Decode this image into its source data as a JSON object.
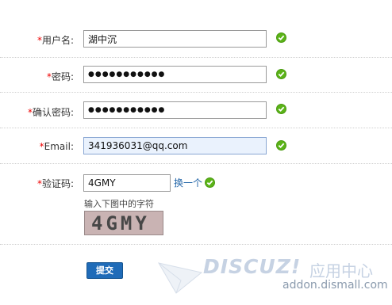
{
  "form": {
    "username": {
      "required_mark": "*",
      "label": "用户名:",
      "value": "湖中沉"
    },
    "password": {
      "required_mark": "*",
      "label": "密码:",
      "value": "●●●●●●●●●●●"
    },
    "confirm_password": {
      "required_mark": "*",
      "label": "确认密码:",
      "value": "●●●●●●●●●●●"
    },
    "email": {
      "required_mark": "*",
      "label": "Email:",
      "value": "341936031@qq.com"
    },
    "captcha": {
      "required_mark": "*",
      "label": "验证码:",
      "value": "4GMY",
      "refresh_link": "换一个",
      "hint": "输入下图中的字符",
      "image_text": "4GMY"
    },
    "submit_label": "提交"
  },
  "logo": {
    "text": "DISCUZ!",
    "cn": "应用中心",
    "url": "addon.dismall.com"
  },
  "colors": {
    "required": "#ee0000",
    "ok": "#5bb318",
    "link": "#2366a8",
    "button": "#1f6bb8"
  }
}
